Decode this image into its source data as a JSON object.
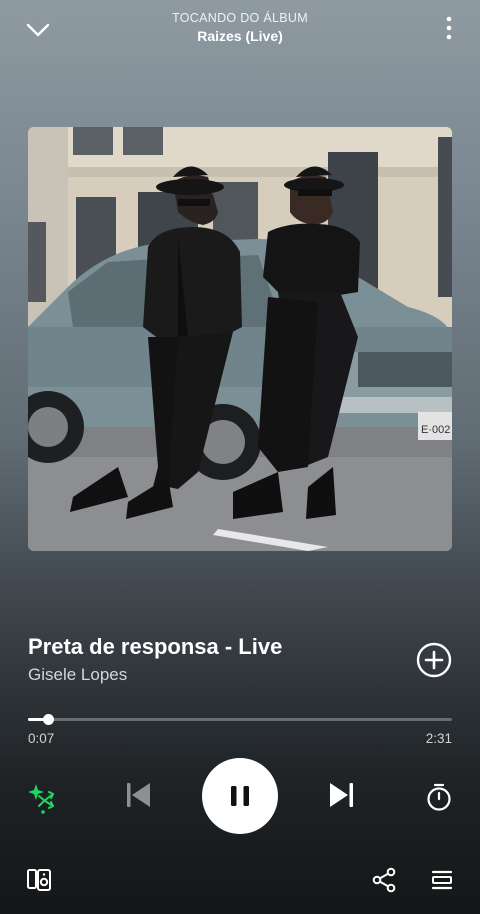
{
  "header": {
    "context_label": "TOCANDO DO ÁLBUM",
    "album_title": "Raizes (Live)",
    "collapse_icon": "chevron-down-icon",
    "more_icon": "more-vertical-icon"
  },
  "artwork": {
    "plate_text": "E·002"
  },
  "track": {
    "title": "Preta de responsa - Live",
    "artist": "Gisele Lopes",
    "add_icon": "plus-circle-icon"
  },
  "playback": {
    "elapsed": "0:07",
    "total": "2:31",
    "progress_fraction": 0.046,
    "state": "playing"
  },
  "controls": {
    "shuffle_icon": "smart-shuffle-icon",
    "previous_icon": "skip-previous-icon",
    "pause_icon": "pause-icon",
    "next_icon": "skip-next-icon",
    "timer_icon": "sleep-timer-icon"
  },
  "footer": {
    "devices_icon": "connect-devices-icon",
    "share_icon": "share-icon",
    "queue_icon": "queue-icon"
  },
  "colors": {
    "accent_green": "#1ed760",
    "text_primary": "#ffffff",
    "text_secondary": "#d3d6d8"
  }
}
